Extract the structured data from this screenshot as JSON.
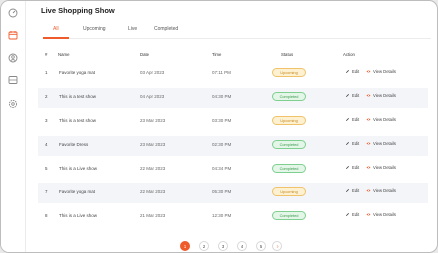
{
  "page": {
    "title": "Live Shopping Show",
    "accent": "#ef5b2a"
  },
  "sidebar": {
    "icons": [
      "dashboard-icon",
      "calendar-icon",
      "users-icon",
      "list-icon",
      "settings-icon"
    ]
  },
  "tabs": [
    "All",
    "Upcoming",
    "Live",
    "Completed"
  ],
  "table": {
    "headers": {
      "num": "#",
      "name": "Name",
      "date": "Date",
      "time": "Time",
      "status": "Status",
      "action": "Action"
    },
    "rows": [
      {
        "num": "1",
        "name": "Favorite yoga mat",
        "date": "03 Apr 2023",
        "time": "07:11 PM",
        "status": "Upcoming",
        "edit": "Edit",
        "view": "View Details"
      },
      {
        "num": "2",
        "name": "This is a test show",
        "date": "04 Apr 2023",
        "time": "04:30 PM",
        "status": "Completed",
        "edit": "Edit",
        "view": "View Details"
      },
      {
        "num": "3",
        "name": "This is a test show",
        "date": "23 Mar 2023",
        "time": "03:30 PM",
        "status": "Upcoming",
        "edit": "Edit",
        "view": "View Details"
      },
      {
        "num": "4",
        "name": "Favorite Dress",
        "date": "23 Mar 2023",
        "time": "02:30 PM",
        "status": "Completed",
        "edit": "Edit",
        "view": "View Details"
      },
      {
        "num": "5",
        "name": "This is a Live show",
        "date": "22 Mar 2023",
        "time": "04:34 PM",
        "status": "Completed",
        "edit": "Edit",
        "view": "View Details"
      },
      {
        "num": "7",
        "name": "Favorite yoga mat",
        "date": "22 Mar 2023",
        "time": "05:30 PM",
        "status": "Upcoming",
        "edit": "Edit",
        "view": "View Details"
      },
      {
        "num": "8",
        "name": "This is a Live show",
        "date": "21 Mar 2023",
        "time": "12:30 PM",
        "status": "Completed",
        "edit": "Edit",
        "view": "View Details"
      }
    ]
  },
  "pagination": {
    "pages": [
      "1",
      "2",
      "3",
      "4",
      "5"
    ],
    "current": "1"
  }
}
